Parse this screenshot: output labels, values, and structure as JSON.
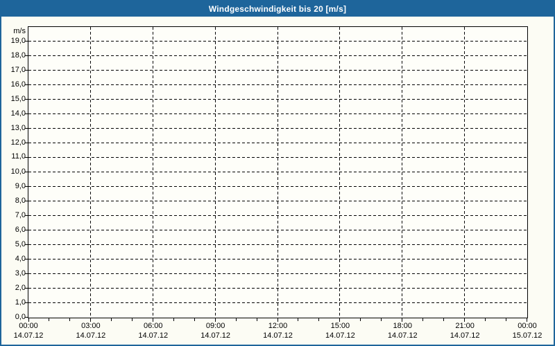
{
  "window": {
    "title": "Windgeschwindigkeit bis 20 [m/s]",
    "colors": {
      "title_bar": "#1E659B",
      "window_border": "#1E659B",
      "background": "#FCFCF4",
      "plot_background": "#FEFEF9",
      "grid": "#000000",
      "text": "#000000",
      "title_text": "#FFFFFF"
    }
  },
  "chart_data": {
    "type": "line",
    "title": "Windgeschwindigkeit bis 20 [m/s]",
    "xlabel": "",
    "ylabel": "m/s",
    "ylim": [
      0,
      20
    ],
    "y_major_step": 1,
    "grid": "dashed",
    "legend": "none",
    "series": [],
    "y_ticks": [
      {
        "value": 19,
        "label": "19,0"
      },
      {
        "value": 18,
        "label": "18,0"
      },
      {
        "value": 17,
        "label": "17,0"
      },
      {
        "value": 16,
        "label": "16,0"
      },
      {
        "value": 15,
        "label": "15,0"
      },
      {
        "value": 14,
        "label": "14,0"
      },
      {
        "value": 13,
        "label": "13,0"
      },
      {
        "value": 12,
        "label": "12,0"
      },
      {
        "value": 11,
        "label": "11,0"
      },
      {
        "value": 10,
        "label": "10,0"
      },
      {
        "value": 9,
        "label": "9,0"
      },
      {
        "value": 8,
        "label": "8,0"
      },
      {
        "value": 7,
        "label": "7,0"
      },
      {
        "value": 6,
        "label": "6,0"
      },
      {
        "value": 5,
        "label": "5,0"
      },
      {
        "value": 4,
        "label": "4,0"
      },
      {
        "value": 3,
        "label": "3,0"
      },
      {
        "value": 2,
        "label": "2,0"
      },
      {
        "value": 1,
        "label": "1,0"
      },
      {
        "value": 0,
        "label": "0,0"
      }
    ],
    "x_range_hours": [
      0,
      24
    ],
    "x_minor_tick_every_hours": 1,
    "x_ticks": [
      {
        "hour": 0,
        "time": "00:00",
        "date": "14.07.12"
      },
      {
        "hour": 3,
        "time": "03:00",
        "date": "14.07.12"
      },
      {
        "hour": 6,
        "time": "06:00",
        "date": "14.07.12"
      },
      {
        "hour": 9,
        "time": "09:00",
        "date": "14.07.12"
      },
      {
        "hour": 12,
        "time": "12:00",
        "date": "14.07.12"
      },
      {
        "hour": 15,
        "time": "15:00",
        "date": "14.07.12"
      },
      {
        "hour": 18,
        "time": "18:00",
        "date": "14.07.12"
      },
      {
        "hour": 21,
        "time": "21:00",
        "date": "14.07.12"
      },
      {
        "hour": 24,
        "time": "00:00",
        "date": "15.07.12"
      }
    ]
  }
}
